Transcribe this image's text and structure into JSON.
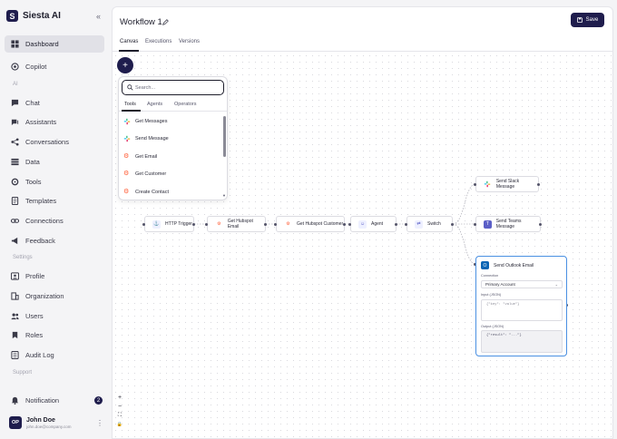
{
  "brand": {
    "name": "Siesta AI",
    "logo_letter": "S"
  },
  "sidebar": {
    "collapse_icon": "chevrons-left-icon",
    "items": [
      {
        "label": "Dashboard",
        "icon": "dashboard-icon",
        "active": true
      },
      {
        "label": "Copilot",
        "icon": "copilot-icon"
      },
      {
        "label": "Chat",
        "icon": "chat-icon"
      },
      {
        "label": "Assistants",
        "icon": "assistants-icon"
      },
      {
        "label": "Conversations",
        "icon": "conversations-icon"
      },
      {
        "label": "Data",
        "icon": "data-icon"
      },
      {
        "label": "Tools",
        "icon": "tools-icon"
      },
      {
        "label": "Templates",
        "icon": "templates-icon"
      },
      {
        "label": "Connections",
        "icon": "connections-icon"
      },
      {
        "label": "Feedback",
        "icon": "feedback-icon"
      },
      {
        "label": "Profile",
        "icon": "profile-icon"
      },
      {
        "label": "Organization",
        "icon": "organization-icon"
      },
      {
        "label": "Users",
        "icon": "users-icon"
      },
      {
        "label": "Roles",
        "icon": "roles-icon"
      },
      {
        "label": "Audit Log",
        "icon": "audit-log-icon"
      }
    ],
    "sections": {
      "ai": "AI",
      "settings": "Settings",
      "support": "Support"
    },
    "notification": {
      "label": "Notification",
      "count": "2"
    },
    "user": {
      "initials": "OP",
      "name": "John Doe",
      "email": "john.doe@company.com"
    }
  },
  "header": {
    "title": "Workflow 1",
    "save_label": "Save"
  },
  "tabs": [
    "Canvas",
    "Executions",
    "Versions"
  ],
  "palette": {
    "search_placeholder": "Search...",
    "tabs": [
      "Tools",
      "Agents",
      "Operators"
    ],
    "items": [
      {
        "label": "Get Messages",
        "icon": "slack-icon"
      },
      {
        "label": "Send Message",
        "icon": "slack-icon"
      },
      {
        "label": "Get Email",
        "icon": "hubspot-icon"
      },
      {
        "label": "Get Customer",
        "icon": "hubspot-icon"
      },
      {
        "label": "Create Contact",
        "icon": "hubspot-icon"
      }
    ]
  },
  "nodes": {
    "http_trigger": "HTTP Trigger",
    "get_hubspot_email": "Get Hubspot Email",
    "get_hubspot_customer": "Get Hubspot Customer",
    "agent": "Agent",
    "switch": "Switch",
    "send_slack": "Send Slack Message",
    "send_teams": "Send Teams Message"
  },
  "outlook_node": {
    "title": "Send Outlook Email",
    "connection_label": "Connection",
    "connection_value": "Primary Account",
    "input_label": "Input (JSON)",
    "input_placeholder": "{\"key\": \"value\"}",
    "output_label": "Output (JSON)",
    "output_value": "{\"result\": \"...\"}"
  },
  "zoom_controls": {
    "zoom_in": "+",
    "zoom_out": "−",
    "fit": "⛶",
    "lock": "🔒"
  },
  "colors": {
    "accent": "#1f1d4d",
    "selected_node_border": "#4a90e2",
    "hubspot": "#ff5c35",
    "teams": "#5b5fc7"
  }
}
